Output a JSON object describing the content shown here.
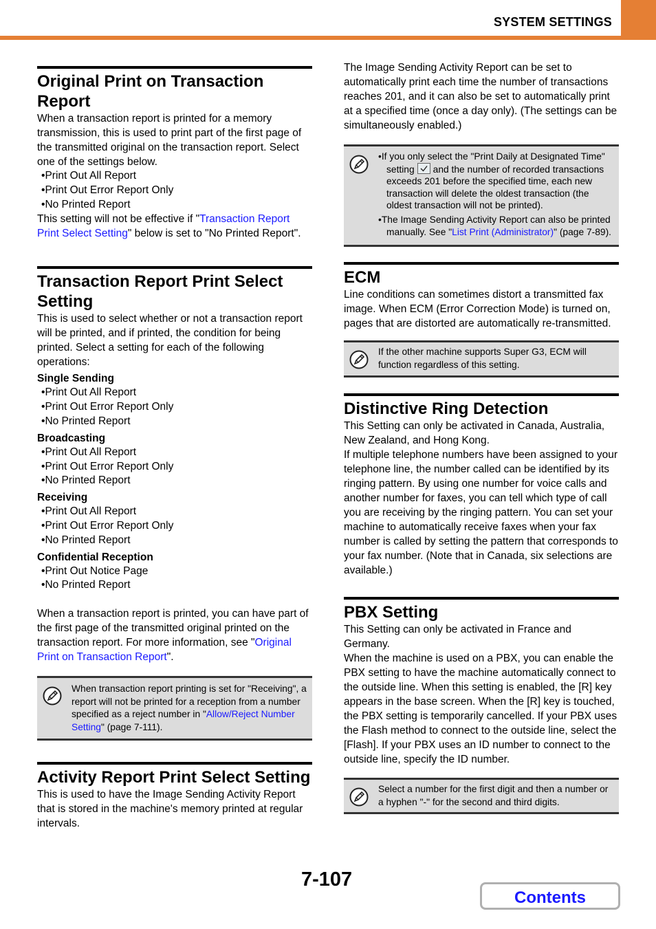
{
  "header": {
    "title": "SYSTEM SETTINGS",
    "accent_color": "#e57f34"
  },
  "left": {
    "s1": {
      "title": "Original Print on Transaction Report",
      "intro": "When a transaction report is printed for a memory transmission, this is used to print part of the first page of the transmitted original on the transaction report. Select one of the settings below.",
      "options": [
        "Print Out All Report",
        "Print Out Error Report Only",
        "No Printed Report"
      ],
      "tail_pre": "This setting will not be effective if \"",
      "tail_link": "Transaction Report Print Select Setting",
      "tail_post": "\" below is set to \"No Printed Report\"."
    },
    "s2": {
      "title": "Transaction Report Print Select Setting",
      "intro": "This is used to select whether or not a transaction report will be printed, and if printed, the condition for being printed. Select a setting for each of the following operations:",
      "groups": [
        {
          "label": "Single Sending",
          "options": [
            "Print Out All Report",
            "Print Out Error Report Only",
            "No Printed Report"
          ]
        },
        {
          "label": "Broadcasting",
          "options": [
            "Print Out All Report",
            "Print Out Error Report Only",
            "No Printed Report"
          ]
        },
        {
          "label": "Receiving",
          "options": [
            "Print Out All Report",
            "Print Out Error Report Only",
            "No Printed Report"
          ]
        },
        {
          "label": "Confidential Reception",
          "options": [
            "Print Out Notice Page",
            "No Printed Report"
          ]
        }
      ],
      "tail_pre": "When a transaction report is printed, you can have part of the first page of the transmitted original printed on the transaction report. For more information, see \"",
      "tail_link": "Original Print on Transaction Report",
      "tail_post": "\".",
      "note_pre": "When transaction report printing is set for \"Receiving\", a report will not be printed for a reception from a number specified as a reject number in \"",
      "note_link": "Allow/Reject Number Setting",
      "note_post": "\" (page 7-111)."
    },
    "s3": {
      "title": "Activity Report Print Select Setting",
      "intro": "This is used to have the Image Sending Activity Report that is stored in the machine's memory printed at regular intervals."
    }
  },
  "right": {
    "intro": "The Image Sending Activity Report can be set to automatically print each time the number of transactions reaches 201, and it can also be set to automatically print at a specified time (once a day only). (The settings can be simultaneously enabled.)",
    "note1": {
      "b1_pre": "If you only select the \"Print Daily at Designated Time\" setting",
      "b1_post": "and the number of recorded transactions exceeds 201 before the specified time, each new transaction will delete the oldest transaction (the oldest transaction will not be printed).",
      "b2_pre": "The Image Sending Activity Report can also be printed manually. See \"",
      "b2_link": "List Print (Administrator)",
      "b2_post": "\" (page 7-89)."
    },
    "ecm": {
      "title": "ECM",
      "body": "Line conditions can sometimes distort a transmitted fax image. When ECM (Error Correction Mode) is turned on, pages that are distorted are automatically re-transmitted.",
      "note": "If the other machine supports Super G3, ECM will function regardless of this setting."
    },
    "ring": {
      "title": "Distinctive Ring Detection",
      "p1": "This Setting can only be activated in Canada, Australia, New Zealand, and Hong Kong.",
      "p2": "If multiple telephone numbers have been assigned to your telephone line, the number called can be identified by its ringing pattern. By using one number for voice calls and another number for faxes, you can tell which type of call you are receiving by the ringing pattern. You can set your machine to automatically receive faxes when your fax number is called by setting the pattern that corresponds to your fax number. (Note that in Canada, six selections are available.)"
    },
    "pbx": {
      "title": "PBX Setting",
      "p1": "This Setting can only be activated in France and Germany.",
      "p2": "When the machine is used on a PBX, you can enable the PBX setting to have the machine automatically connect to the outside line. When this setting is enabled, the [R] key appears in the base screen. When the [R] key is touched, the PBX setting is temporarily cancelled. If your PBX uses the Flash method to connect to the outside line, select the [Flash]. If your PBX uses an ID number to connect to the outside line, specify the ID number.",
      "note": "Select a number for the first digit and then a number or a hyphen \"-\" for the second and third digits."
    }
  },
  "footer": {
    "page_number": "7-107",
    "contents_label": "Contents"
  }
}
